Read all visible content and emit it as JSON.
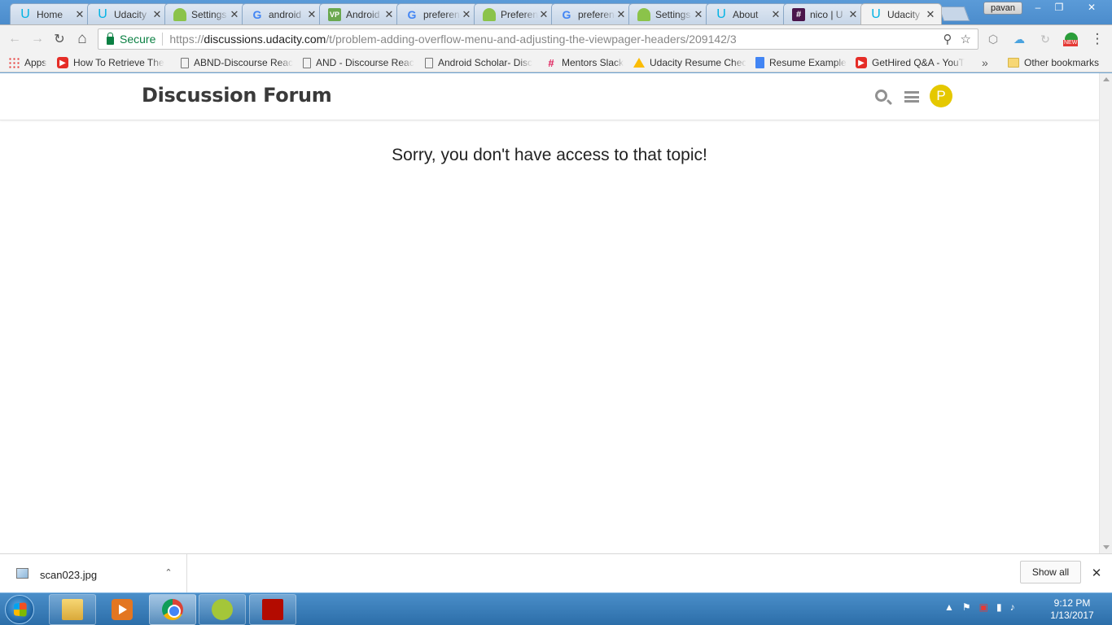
{
  "window": {
    "profile_name": "pavan",
    "minimize_glyph": "–",
    "restore_glyph": "❐",
    "close_glyph": "✕"
  },
  "tabs": [
    {
      "title": "Home",
      "icon": "udacity-icon",
      "active": false
    },
    {
      "title": "Udacity",
      "icon": "udacity-icon",
      "active": false
    },
    {
      "title": "Settings",
      "icon": "android-icon",
      "active": false
    },
    {
      "title": "android",
      "icon": "google-icon",
      "active": false
    },
    {
      "title": "Android",
      "icon": "vp-icon",
      "active": false
    },
    {
      "title": "preference",
      "icon": "google-icon",
      "active": false
    },
    {
      "title": "Preference",
      "icon": "android-icon",
      "active": false
    },
    {
      "title": "preference",
      "icon": "google-icon",
      "active": false
    },
    {
      "title": "Settings",
      "icon": "android-icon",
      "active": false
    },
    {
      "title": "About",
      "icon": "udacity-icon",
      "active": false
    },
    {
      "title": "nico | U",
      "icon": "slack-icon",
      "active": false
    },
    {
      "title": "Udacity",
      "icon": "udacity-icon",
      "active": true
    }
  ],
  "toolbar": {
    "back_glyph": "←",
    "forward_glyph": "→",
    "reload_glyph": "↻",
    "home_glyph": "⌂",
    "secure_label": "Secure",
    "url_scheme": "https://",
    "url_host": "discussions.udacity.com",
    "url_path": "/t/problem-adding-overflow-menu-and-adjusting-the-viewpager-headers/209142/3",
    "zoom_glyph": "⚲",
    "star_glyph": "☆",
    "menu_glyph": "⋮",
    "ext_badge": "NEW"
  },
  "bookmarks": [
    {
      "label": "Apps",
      "icon": "apps-grid-icon"
    },
    {
      "label": "How To Retrieve The",
      "icon": "youtube-icon"
    },
    {
      "label": "ABND-Discourse Reac",
      "icon": "page-icon"
    },
    {
      "label": "AND - Discourse Reac",
      "icon": "page-icon"
    },
    {
      "label": "Android Scholar- Disc",
      "icon": "page-icon"
    },
    {
      "label": "Mentors Slack",
      "icon": "slack-icon"
    },
    {
      "label": "Udacity Resume Chec",
      "icon": "drive-icon"
    },
    {
      "label": "Resume Example",
      "icon": "docs-icon"
    },
    {
      "label": "GetHired Q&A - YouT",
      "icon": "youtube-icon"
    }
  ],
  "bookmarks_overflow": "»",
  "other_bookmarks": "Other bookmarks",
  "site": {
    "title": "Discussion Forum",
    "avatar_letter": "P",
    "message": "Sorry, you don't have access to that topic!"
  },
  "downloads": {
    "filename": "scan023.jpg",
    "chevron": "⌃",
    "show_all": "Show all",
    "close_glyph": "✕"
  },
  "taskbar": {
    "apps": [
      "file-explorer",
      "media-player",
      "chrome",
      "android-studio",
      "acrobat"
    ],
    "active_app": "chrome",
    "time": "9:12 PM",
    "date": "1/13/2017"
  },
  "colors": {
    "avatar": "#e5c800",
    "secure_green": "#0b8043",
    "udacity_blue": "#02b3e4"
  }
}
